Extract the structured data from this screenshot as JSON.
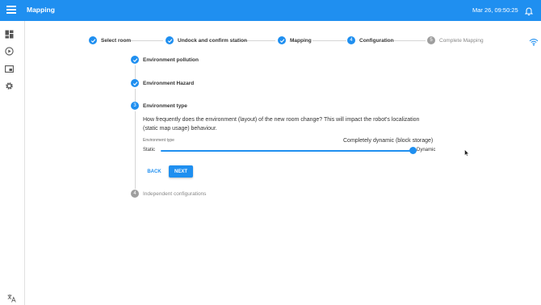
{
  "topbar": {
    "title": "Mapping",
    "datetime": "Mar 26, 09:50:25"
  },
  "sidebar": {
    "items": [
      {
        "icon": "dashboard-icon"
      },
      {
        "icon": "play-circle-icon"
      },
      {
        "icon": "screen-icon"
      },
      {
        "icon": "gear-icon"
      }
    ],
    "bottom_icon": "translate-icon"
  },
  "stepper": {
    "steps": [
      {
        "label": "Select room",
        "state": "done",
        "number": "1"
      },
      {
        "label": "Undock and confirm station",
        "state": "done",
        "number": "2"
      },
      {
        "label": "Mapping",
        "state": "done",
        "number": "3"
      },
      {
        "label": "Configuration",
        "state": "active",
        "number": "4"
      },
      {
        "label": "Complete Mapping",
        "state": "todo",
        "number": "5"
      }
    ]
  },
  "config": {
    "substeps": [
      {
        "label": "Environment pollution",
        "state": "done"
      },
      {
        "label": "Environment Hazard",
        "state": "done"
      },
      {
        "label": "Environment type",
        "state": "active",
        "number": "3"
      },
      {
        "label": "Independent configurations",
        "state": "todo",
        "number": "4"
      }
    ],
    "question": "How frequently does the environment (layout) of the new room change? This will impact the robot's localization (static map usage) behaviour.",
    "slider": {
      "field_label": "Environment type",
      "value_label": "Completely dynamic (block storage)",
      "min_label": "Static",
      "max_label": "Dynamic",
      "value_fraction": 1.0
    },
    "back_label": "BACK",
    "next_label": "NEXT"
  },
  "colors": {
    "primary": "#1f8ff0",
    "inactive": "#9e9e9e"
  }
}
